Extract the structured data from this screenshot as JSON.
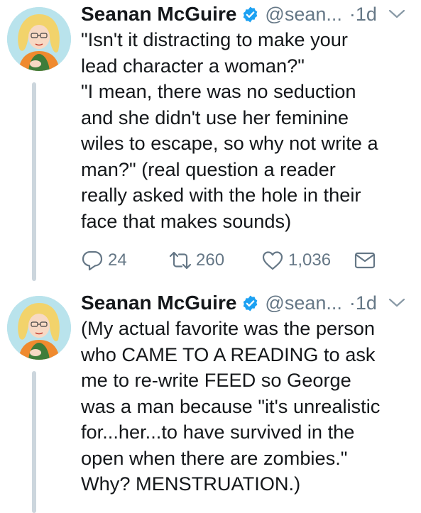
{
  "tweets": [
    {
      "author_name": "Seanan McGuire",
      "handle": "@sean...",
      "dot": "·",
      "time": "1d",
      "lines": [
        "\"Isn't it distracting to make your",
        "lead character a woman?\"",
        "\"I mean, there was no seduction",
        "and she didn't use her feminine",
        "wiles to escape, so why not write a",
        "man?\" (real question a reader",
        "really asked with the hole in their",
        "face that makes sounds)"
      ],
      "replies": "24",
      "retweets": "260",
      "likes": "1,036"
    },
    {
      "author_name": "Seanan McGuire",
      "handle": "@sean...",
      "dot": "·",
      "time": "1d",
      "lines": [
        "(My actual favorite was the person",
        "who CAME TO A READING to ask",
        "me to re-write FEED so George",
        "was a man because \"it's unrealistic",
        "for...her...to have survived in the",
        "open when there are zombies.\"",
        "Why? MENSTRUATION.)"
      ]
    }
  ],
  "icons": {
    "reply": "reply-icon",
    "retweet": "retweet-icon",
    "like": "heart-icon",
    "dm": "envelope-icon",
    "verified": "verified-badge-icon",
    "caret": "chevron-down-icon"
  },
  "colors": {
    "text": "#14171a",
    "muted": "#657786",
    "verified": "#1da1f2",
    "thread_line": "#ccd6dd"
  }
}
